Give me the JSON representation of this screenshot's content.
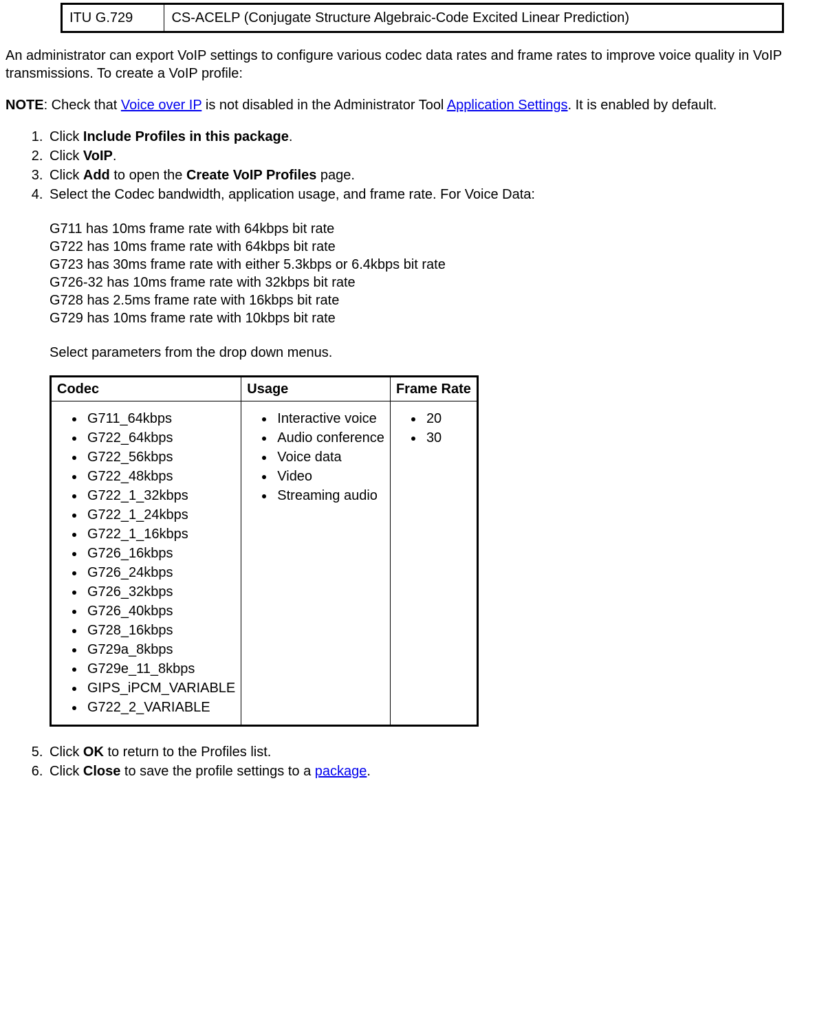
{
  "topTable": {
    "cell1": "ITU G.729",
    "cell2": "CS-ACELP (Conjugate Structure Algebraic-Code Excited Linear Prediction)"
  },
  "introPara": "An administrator can export VoIP settings to configure various codec data rates and frame rates to improve voice quality in VoIP transmissions. To create a VoIP profile:",
  "notePrefix": "NOTE",
  "noteText1": ": Check that ",
  "noteLink1": "Voice over IP",
  "noteText2": " is not disabled in the Administrator Tool ",
  "noteLink2": "Application Settings",
  "noteText3": ". It is enabled by default.",
  "steps": {
    "s1a": "Click ",
    "s1b": "Include Profiles in this package",
    "s1c": ".",
    "s2a": "Click ",
    "s2b": "VoIP",
    "s2c": ".",
    "s3a": "Click ",
    "s3b": "Add",
    "s3c": " to open the ",
    "s3d": "Create VoIP Profiles",
    "s3e": " page.",
    "s4a": "Select the Codec bandwidth, application usage, and frame rate. For Voice Data:",
    "codecDetails": [
      "G711 has 10ms frame rate with 64kbps bit rate",
      "G722 has 10ms frame rate with 64kbps bit rate",
      "G723 has 30ms frame rate with either 5.3kbps or 6.4kbps bit rate",
      "G726-32 has 10ms frame rate with 32kbps bit rate",
      "G728 has 2.5ms frame rate with 16kbps bit rate",
      "G729 has 10ms frame rate with 10kbps bit rate"
    ],
    "selectParams": "Select parameters from the drop down menus.",
    "paramHeaders": {
      "h1": "Codec",
      "h2": "Usage",
      "h3": "Frame Rate"
    },
    "codecList": [
      "G711_64kbps",
      "G722_64kbps",
      "G722_56kbps",
      "G722_48kbps",
      "G722_1_32kbps",
      "G722_1_24kbps",
      "G722_1_16kbps",
      "G726_16kbps",
      "G726_24kbps",
      "G726_32kbps",
      "G726_40kbps",
      "G728_16kbps",
      "G729a_8kbps",
      "G729e_11_8kbps",
      "GIPS_iPCM_VARIABLE",
      "G722_2_VARIABLE"
    ],
    "usageList": [
      "Interactive voice",
      "Audio conference",
      "Voice data",
      "Video",
      "Streaming audio"
    ],
    "frameRateList": [
      "20",
      "30"
    ],
    "s5a": "Click ",
    "s5b": "OK",
    "s5c": " to return to the Profiles list.",
    "s6a": "Click ",
    "s6b": "Close",
    "s6c": " to save the profile settings to a ",
    "s6link": "package",
    "s6d": "."
  }
}
